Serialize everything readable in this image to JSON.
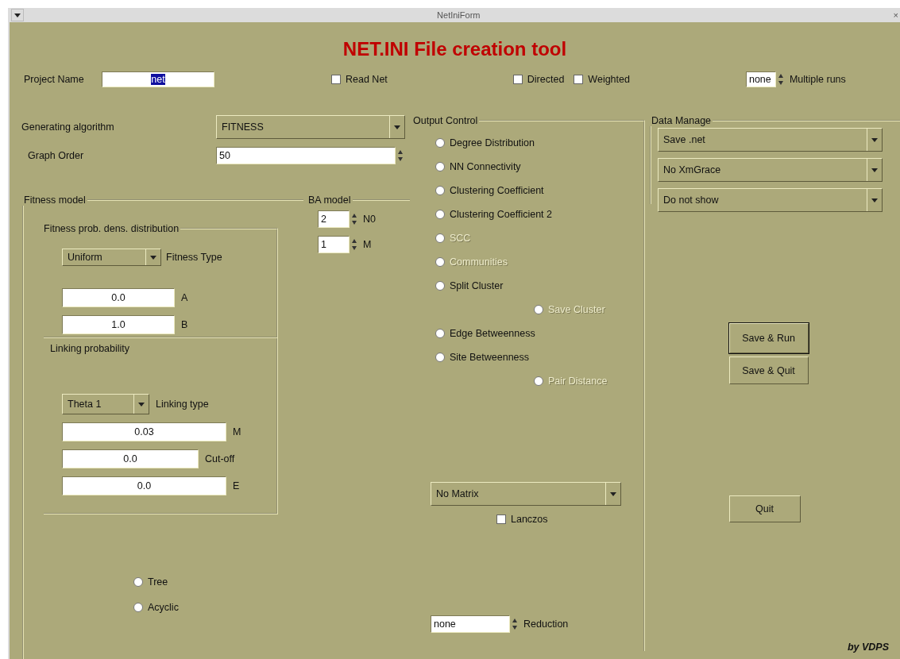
{
  "window": {
    "title": "NetIniForm",
    "close": "×"
  },
  "heading": "NET.INI File creation tool",
  "project_name": {
    "label": "Project Name",
    "value": "net",
    "text_selected": true
  },
  "read_net": {
    "label": "Read Net",
    "checked": false
  },
  "directed": {
    "label": "Directed",
    "checked": false
  },
  "weighted": {
    "label": "Weighted",
    "checked": false
  },
  "multiple_runs": {
    "value": "none",
    "label": "Multiple runs"
  },
  "generating_algorithm": {
    "label": "Generating algorithm",
    "value": "FITNESS"
  },
  "graph_order": {
    "label": "Graph Order",
    "value": "50"
  },
  "fitness_model": {
    "title": "Fitness model",
    "distribution": {
      "title": "Fitness prob. dens. distribution",
      "type": {
        "value": "Uniform",
        "label": "Fitness Type"
      },
      "fields": [
        {
          "value": "0.0",
          "label": "A"
        },
        {
          "value": "1.0",
          "label": "B"
        }
      ]
    },
    "linking": {
      "title": "Linking probability",
      "type": {
        "value": "Theta 1",
        "label": "Linking type"
      },
      "fields": [
        {
          "value": "0.03",
          "label": "M"
        },
        {
          "value": "0.0",
          "label": "Cut-off"
        },
        {
          "value": "0.0",
          "label": "E"
        }
      ]
    },
    "options": [
      {
        "label": "Tree",
        "selected": false
      },
      {
        "label": "Acyclic",
        "selected": false
      }
    ]
  },
  "ba_model": {
    "title": "BA model",
    "params": [
      {
        "value": "2",
        "label": "N0"
      },
      {
        "value": "1",
        "label": "M"
      }
    ]
  },
  "output_control": {
    "title": "Output Control",
    "options": [
      {
        "label": "Degree Distribution",
        "kind": "main",
        "selected": false,
        "disabled": false
      },
      {
        "label": "NN Connectivity",
        "kind": "main",
        "selected": false,
        "disabled": false
      },
      {
        "label": "Clustering Coefficient",
        "kind": "main",
        "selected": false,
        "disabled": false
      },
      {
        "label": "Clustering Coefficient 2",
        "kind": "main",
        "selected": false,
        "disabled": false
      },
      {
        "label": "SCC",
        "kind": "main",
        "selected": false,
        "disabled": true
      },
      {
        "label": "Communities",
        "kind": "main",
        "selected": false,
        "disabled": true
      },
      {
        "label": "Split Cluster",
        "kind": "main",
        "selected": false,
        "disabled": false
      },
      {
        "label": "Save Cluster",
        "kind": "sub",
        "selected": false,
        "disabled": true
      },
      {
        "label": "Edge Betweenness",
        "kind": "main",
        "selected": false,
        "disabled": false
      },
      {
        "label": "Site Betweenness",
        "kind": "main",
        "selected": false,
        "disabled": false
      },
      {
        "label": "Pair Distance",
        "kind": "sub",
        "selected": false,
        "disabled": true
      }
    ],
    "matrix": {
      "value": "No Matrix"
    },
    "lanczos": {
      "label": "Lanczos",
      "checked": false
    },
    "reduction": {
      "value": "none",
      "label": "Reduction"
    }
  },
  "data_manage": {
    "title": "Data Manage",
    "selects": [
      "Save .net",
      "No XmGrace",
      "Do not show"
    ]
  },
  "buttons": [
    {
      "label": "Save & Run",
      "focused": true
    },
    {
      "label": "Save & Quit",
      "focused": false
    },
    {
      "label": "Quit",
      "focused": false
    }
  ],
  "credit": "by VDPS"
}
